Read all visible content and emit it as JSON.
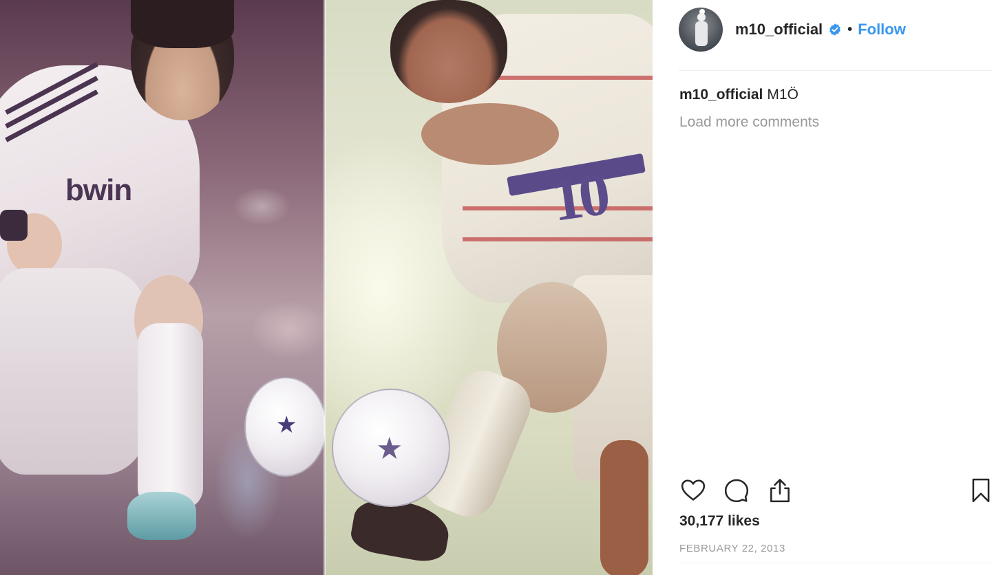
{
  "post": {
    "username": "m10_official",
    "follow_label": "Follow",
    "separator": "•",
    "caption_username": "m10_official",
    "caption_text": "M1Ö",
    "load_more": "Load more comments",
    "likes": "30,177 likes",
    "date": "FEBRUARY 22, 2013"
  },
  "media": {
    "left_sponsor": "bwin",
    "right_number": "10"
  },
  "icons": {
    "verified": "verified-badge-icon",
    "like": "heart-icon",
    "comment": "comment-bubble-icon",
    "share": "share-upload-icon",
    "save": "bookmark-icon"
  },
  "colors": {
    "link": "#3897f0",
    "text": "#262626",
    "muted": "#999999",
    "verified": "#3897f0"
  }
}
